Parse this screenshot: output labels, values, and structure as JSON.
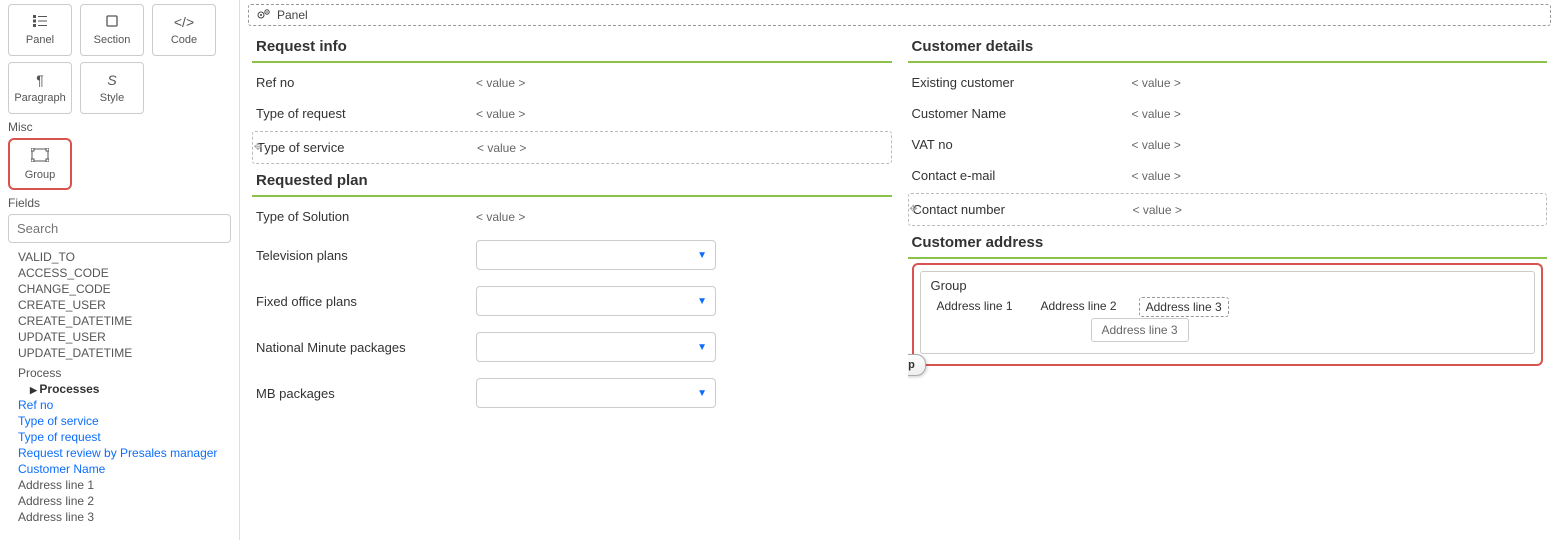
{
  "tools_row1": [
    {
      "icon": "list-icon",
      "label": "Panel"
    },
    {
      "icon": "square-icon",
      "label": "Section"
    },
    {
      "icon": "code-icon",
      "label": "Code"
    }
  ],
  "tools_row2": [
    {
      "icon": "pilcrow-icon",
      "label": "Paragraph"
    },
    {
      "icon": "style-icon",
      "label": "Style"
    }
  ],
  "misc_label": "Misc",
  "group_tool": {
    "label": "Group"
  },
  "fields_label": "Fields",
  "search_placeholder": "Search",
  "field_items": [
    {
      "text": "VALID_TO",
      "link": false
    },
    {
      "text": "ACCESS_CODE",
      "link": false
    },
    {
      "text": "CHANGE_CODE",
      "link": false
    },
    {
      "text": "CREATE_USER",
      "link": false
    },
    {
      "text": "CREATE_DATETIME",
      "link": false
    },
    {
      "text": "UPDATE_USER",
      "link": false
    },
    {
      "text": "UPDATE_DATETIME",
      "link": false
    }
  ],
  "process_head": "Process",
  "processes_label": "Processes",
  "link_items": [
    "Ref no",
    "Type of service",
    "Type of request",
    "Request review by Presales manager",
    "Customer Name"
  ],
  "addr_items": [
    "Address line 1",
    "Address line 2",
    "Address line 3"
  ],
  "panel_bar": "Panel",
  "value_ph": "< value >",
  "left": {
    "request_info": {
      "title": "Request info",
      "rows": [
        "Ref no",
        "Type of request",
        "Type of service"
      ]
    },
    "requested_plan": {
      "title": "Requested plan",
      "type_of_solution": "Type of Solution",
      "selects": [
        "Television plans",
        "Fixed office plans",
        "National Minute packages",
        "MB packages"
      ]
    }
  },
  "right": {
    "customer_details": {
      "title": "Customer details",
      "rows": [
        "Existing customer",
        "Customer Name",
        "VAT no",
        "Contact e-mail",
        "Contact number"
      ]
    },
    "customer_address": {
      "title": "Customer address",
      "group_label": "Group",
      "chips": [
        "Address line 1",
        "Address line 2",
        "Address line 3"
      ],
      "dragging": "Address line 3"
    }
  },
  "drag_tooltip": "Drag and Drop"
}
